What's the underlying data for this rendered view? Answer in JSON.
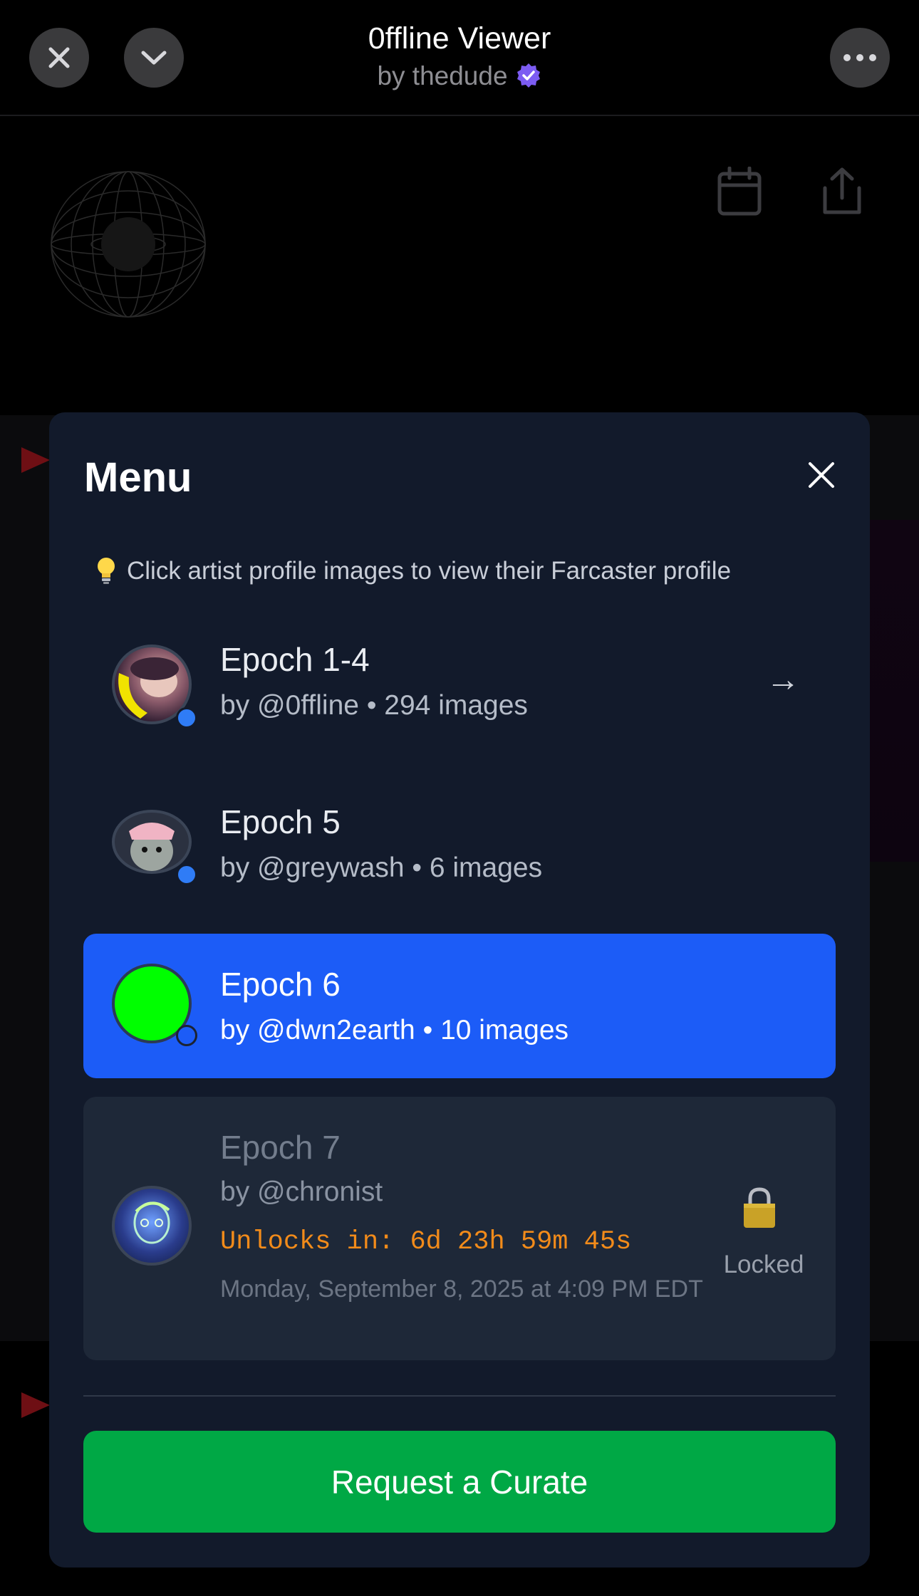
{
  "header": {
    "title": "0ffline Viewer",
    "byline": "by thedude",
    "close_icon": "close-icon",
    "collapse_icon": "chevron-down-icon",
    "more_icon": "more-icon",
    "verified_icon": "verified-badge-icon"
  },
  "toolbar": {
    "calendar_icon": "calendar-icon",
    "share_icon": "share-icon"
  },
  "menu": {
    "title": "Menu",
    "tip_icon": "lightbulb-icon",
    "tip_text": "Click artist profile images to view their Farcaster profile",
    "items": [
      {
        "title": "Epoch 1-4",
        "subtitle": "by @0ffline • 294 images",
        "arrow": "→",
        "state": "default"
      },
      {
        "title": "Epoch 5",
        "subtitle": "by @greywash • 6 images",
        "state": "default"
      },
      {
        "title": "Epoch 6",
        "subtitle": "by @dwn2earth • 10 images",
        "state": "active"
      },
      {
        "title": "Epoch 7",
        "subtitle": "by @chronist",
        "state": "locked",
        "countdown": "Unlocks in: 6d 23h 59m 45s",
        "unlock_date": "Monday, September 8, 2025 at 4:09 PM EDT",
        "lock_label": "Locked"
      }
    ],
    "cta_label": "Request a Curate"
  },
  "colors": {
    "modal_bg": "#121a2b",
    "active_row": "#1c5cf7",
    "locked_row": "#1e2838",
    "cta": "#00a845",
    "countdown": "#f28b1a",
    "dot": "#2f7cf6",
    "epoch6_avatar": "#00ff00"
  }
}
